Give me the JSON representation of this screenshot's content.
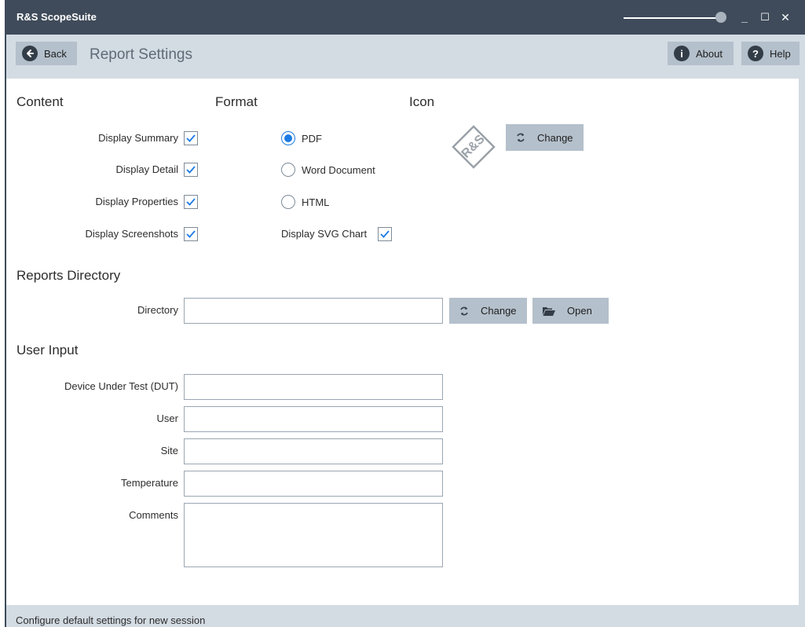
{
  "window": {
    "title": "R&S ScopeSuite",
    "zoom_fraction": 0.95,
    "minimize_glyph": "_",
    "maximize_glyph": "☐",
    "close_glyph": "✕"
  },
  "nav": {
    "back_label": "Back",
    "page_title": "Report Settings",
    "about_label": "About",
    "help_label": "Help",
    "back_icon": "arrow-left-icon",
    "about_icon": "info-icon",
    "help_icon": "question-icon"
  },
  "content": {
    "heading": "Content",
    "options": [
      {
        "label": "Display Summary",
        "checked": true
      },
      {
        "label": "Display Detail",
        "checked": true
      },
      {
        "label": "Display Properties",
        "checked": true
      },
      {
        "label": "Display Screenshots",
        "checked": true
      }
    ]
  },
  "format": {
    "heading": "Format",
    "options": [
      {
        "label": "PDF",
        "selected": true
      },
      {
        "label": "Word Document",
        "selected": false
      },
      {
        "label": "HTML",
        "selected": false
      }
    ],
    "svg_chart": {
      "label": "Display SVG Chart",
      "checked": true
    }
  },
  "icon": {
    "heading": "Icon",
    "logo_text": "R&S",
    "change_label": "Change"
  },
  "reports_directory": {
    "heading": "Reports Directory",
    "directory_label": "Directory",
    "directory_value": "",
    "change_label": "Change",
    "open_label": "Open"
  },
  "user_input": {
    "heading": "User Input",
    "fields": [
      {
        "label": "Device Under Test (DUT)",
        "value": ""
      },
      {
        "label": "User",
        "value": ""
      },
      {
        "label": "Site",
        "value": ""
      },
      {
        "label": "Temperature",
        "value": ""
      },
      {
        "label": "Comments",
        "value": ""
      }
    ]
  },
  "status": {
    "text": "Configure default settings for new session"
  },
  "colors": {
    "titlebar": "#3f4b5a",
    "chrome": "#d3dbe3",
    "button": "#b4c0cb",
    "accent": "#1d7be5"
  }
}
